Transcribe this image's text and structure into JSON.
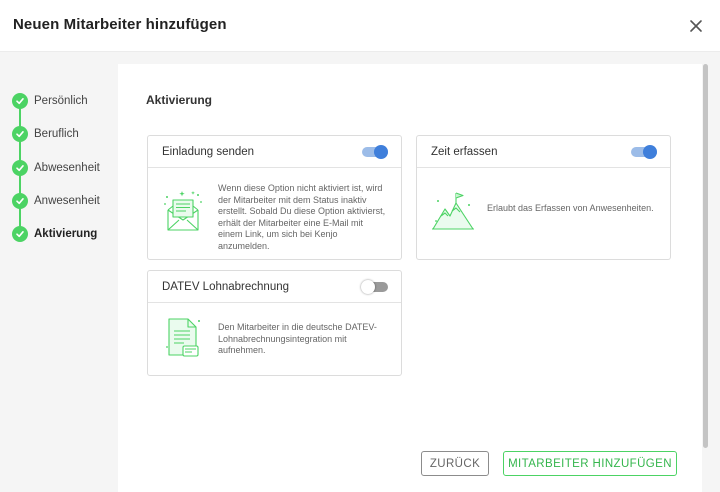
{
  "dialog": {
    "title": "Neuen Mitarbeiter hinzufügen",
    "close_icon": "close-icon"
  },
  "steps": [
    {
      "label": "Persönlich",
      "status": "completed"
    },
    {
      "label": "Beruflich",
      "status": "completed"
    },
    {
      "label": "Abwesenheit",
      "status": "completed"
    },
    {
      "label": "Anwesenheit",
      "status": "completed"
    },
    {
      "label": "Aktivierung",
      "status": "current"
    }
  ],
  "section": {
    "title": "Aktivierung"
  },
  "cards": {
    "invite": {
      "title": "Einladung senden",
      "enabled": true,
      "icon": "envelope-icon",
      "description": "Wenn diese Option nicht aktiviert ist, wird der Mitarbeiter mit dem Status inaktiv erstellt. Sobald Du diese Option aktivierst, erhält der Mitarbeiter eine E-Mail mit einem Link, um sich bei Kenjo anzumelden."
    },
    "time": {
      "title": "Zeit erfassen",
      "enabled": true,
      "icon": "mountain-flag-icon",
      "description": "Erlaubt das Erfassen von Anwesenheiten."
    },
    "datev": {
      "title": "DATEV Lohnabrechnung",
      "enabled": false,
      "icon": "document-icon",
      "description": "Den Mitarbeiter in die deutsche DATEV-Lohnabrechnungsintegration mit aufnehmen."
    }
  },
  "buttons": {
    "back": "ZURÜCK",
    "add": "MITARBEITER HINZUFÜGEN"
  },
  "colors": {
    "accent_green": "#4cd364",
    "toggle_blue": "#3f7fdb"
  }
}
